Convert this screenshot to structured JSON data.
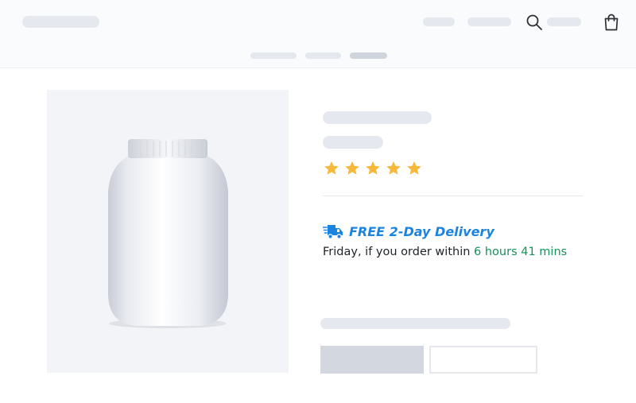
{
  "header": {
    "search_icon": "search-icon",
    "cart_icon": "shopping-bag-icon"
  },
  "product": {
    "image_icon": "supplement-jar",
    "rating": 5,
    "rating_max": 5,
    "star_color": "#f6b93b"
  },
  "delivery": {
    "icon": "fast-delivery-truck-icon",
    "title": "FREE 2-Day Delivery",
    "text_prefix": "Friday, if you order within ",
    "countdown": "6 hours 41 mins",
    "title_color": "#1b84e0",
    "countdown_color": "#16915a"
  }
}
